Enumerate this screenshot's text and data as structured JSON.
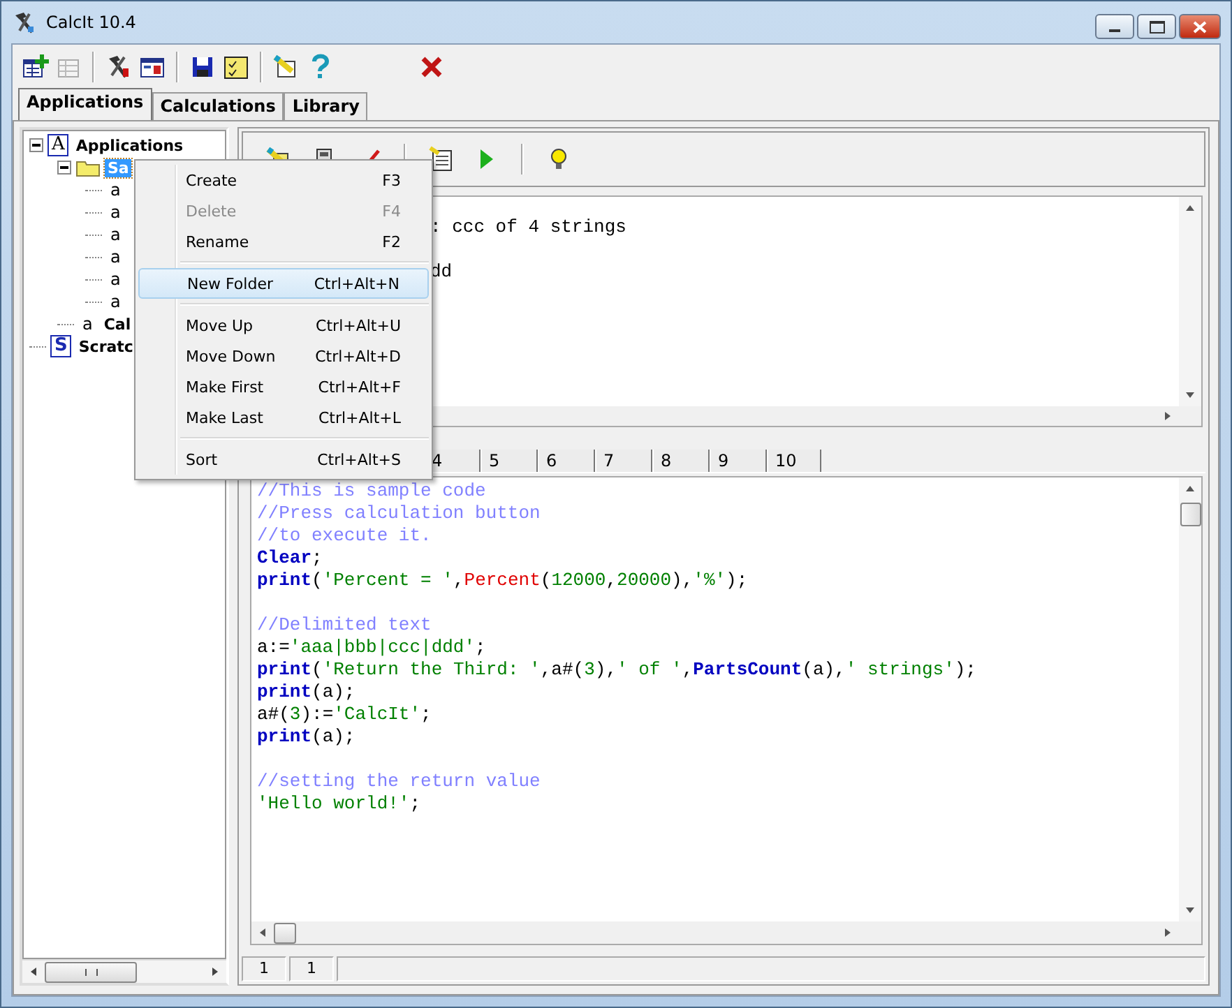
{
  "window": {
    "title": "CalcIt 10.4"
  },
  "main_tabs": [
    {
      "label": "Applications",
      "selected": true
    },
    {
      "label": "Calculations",
      "selected": false
    },
    {
      "label": "Library",
      "selected": false
    }
  ],
  "tree": [
    {
      "label": "Applications",
      "icon": "A",
      "kind": "boxed",
      "expanded": true,
      "selected": false,
      "children": [
        {
          "label": "Sa",
          "kind": "folder",
          "expanded": true,
          "selected": true,
          "children": [
            {
              "icon": "a",
              "kind": "plain"
            },
            {
              "icon": "a",
              "kind": "plain"
            },
            {
              "icon": "a",
              "kind": "plain"
            },
            {
              "icon": "a",
              "kind": "plain"
            },
            {
              "icon": "a",
              "kind": "plain"
            },
            {
              "icon": "a",
              "kind": "plain"
            }
          ]
        },
        {
          "label": "Cal",
          "icon": "a",
          "kind": "plain",
          "selected": false
        }
      ]
    },
    {
      "label": "Scratc",
      "icon": "S",
      "kind": "boxed",
      "selected": false
    }
  ],
  "output": {
    "lines": [
      {
        "text": ": ccc of 4 strings",
        "spaced": false
      },
      {
        "text": "dd",
        "spaced": true
      }
    ]
  },
  "page_tabs": [
    {
      "label": "4"
    },
    {
      "label": "5"
    },
    {
      "label": "6"
    },
    {
      "label": "7"
    },
    {
      "label": "8"
    },
    {
      "label": "9"
    },
    {
      "label": "10"
    }
  ],
  "code": [
    {
      "spaced": false,
      "segments": [
        {
          "kind": "comment",
          "text": "//This is sample code"
        }
      ]
    },
    {
      "spaced": false,
      "segments": [
        {
          "kind": "comment",
          "text": "//Press calculation button"
        }
      ]
    },
    {
      "spaced": false,
      "segments": [
        {
          "kind": "comment",
          "text": "//to execute it."
        }
      ]
    },
    {
      "spaced": false,
      "segments": [
        {
          "kind": "keyword",
          "text": "Clear"
        },
        {
          "kind": "plain",
          "text": ";"
        }
      ]
    },
    {
      "spaced": false,
      "segments": [
        {
          "kind": "keyword",
          "text": "print"
        },
        {
          "kind": "plain",
          "text": "("
        },
        {
          "kind": "string",
          "text": "'Percent = '"
        },
        {
          "kind": "plain",
          "text": ","
        },
        {
          "kind": "function",
          "text": "Percent"
        },
        {
          "kind": "plain",
          "text": "("
        },
        {
          "kind": "string",
          "text": "12000"
        },
        {
          "kind": "plain",
          "text": ","
        },
        {
          "kind": "string",
          "text": "20000"
        },
        {
          "kind": "plain",
          "text": "),"
        },
        {
          "kind": "string",
          "text": "'%'"
        },
        {
          "kind": "plain",
          "text": ");"
        }
      ]
    },
    {
      "spaced": true,
      "segments": [
        {
          "kind": "comment",
          "text": "//Delimited text"
        }
      ]
    },
    {
      "spaced": false,
      "segments": [
        {
          "kind": "plain",
          "text": "a:="
        },
        {
          "kind": "string",
          "text": "'aaa|bbb|ccc|ddd'"
        },
        {
          "kind": "plain",
          "text": ";"
        }
      ]
    },
    {
      "spaced": false,
      "segments": [
        {
          "kind": "keyword",
          "text": "print"
        },
        {
          "kind": "plain",
          "text": "("
        },
        {
          "kind": "string",
          "text": "'Return the Third: '"
        },
        {
          "kind": "plain",
          "text": ",a#("
        },
        {
          "kind": "string",
          "text": "3"
        },
        {
          "kind": "plain",
          "text": "),"
        },
        {
          "kind": "string",
          "text": "' of '"
        },
        {
          "kind": "plain",
          "text": ","
        },
        {
          "kind": "keyword",
          "text": "PartsCount"
        },
        {
          "kind": "plain",
          "text": "(a),"
        },
        {
          "kind": "string",
          "text": "' strings'"
        },
        {
          "kind": "plain",
          "text": ");"
        }
      ]
    },
    {
      "spaced": false,
      "segments": [
        {
          "kind": "keyword",
          "text": "print"
        },
        {
          "kind": "plain",
          "text": "(a);"
        }
      ]
    },
    {
      "spaced": false,
      "segments": [
        {
          "kind": "plain",
          "text": "a#("
        },
        {
          "kind": "string",
          "text": "3"
        },
        {
          "kind": "plain",
          "text": "):="
        },
        {
          "kind": "string",
          "text": "'CalcIt'"
        },
        {
          "kind": "plain",
          "text": ";"
        }
      ]
    },
    {
      "spaced": false,
      "segments": [
        {
          "kind": "keyword",
          "text": "print"
        },
        {
          "kind": "plain",
          "text": "(a);"
        }
      ]
    },
    {
      "spaced": true,
      "segments": [
        {
          "kind": "comment",
          "text": "//setting the return value"
        }
      ]
    },
    {
      "spaced": false,
      "segments": [
        {
          "kind": "string",
          "text": "'Hello world!'"
        },
        {
          "kind": "plain",
          "text": ";"
        }
      ]
    }
  ],
  "status_bar": [
    "1",
    "1"
  ],
  "context_menu": [
    {
      "kind": "item",
      "label": "Create",
      "shortcut": "F3",
      "disabled": false,
      "selected": false
    },
    {
      "kind": "item",
      "label": "Delete",
      "shortcut": "F4",
      "disabled": true,
      "selected": false
    },
    {
      "kind": "item",
      "label": "Rename",
      "shortcut": "F2",
      "disabled": false,
      "selected": false
    },
    {
      "kind": "separator"
    },
    {
      "kind": "item",
      "label": "New Folder",
      "shortcut": "Ctrl+Alt+N",
      "disabled": false,
      "selected": true
    },
    {
      "kind": "separator"
    },
    {
      "kind": "item",
      "label": "Move Up",
      "shortcut": "Ctrl+Alt+U",
      "disabled": false,
      "selected": false
    },
    {
      "kind": "item",
      "label": "Move Down",
      "shortcut": "Ctrl+Alt+D",
      "disabled": false,
      "selected": false
    },
    {
      "kind": "item",
      "label": "Make First",
      "shortcut": "Ctrl+Alt+F",
      "disabled": false,
      "selected": false
    },
    {
      "kind": "item",
      "label": "Make Last",
      "shortcut": "Ctrl+Alt+L",
      "disabled": false,
      "selected": false
    },
    {
      "kind": "separator"
    },
    {
      "kind": "item",
      "label": "Sort",
      "shortcut": "Ctrl+Alt+S",
      "disabled": false,
      "selected": false
    }
  ]
}
